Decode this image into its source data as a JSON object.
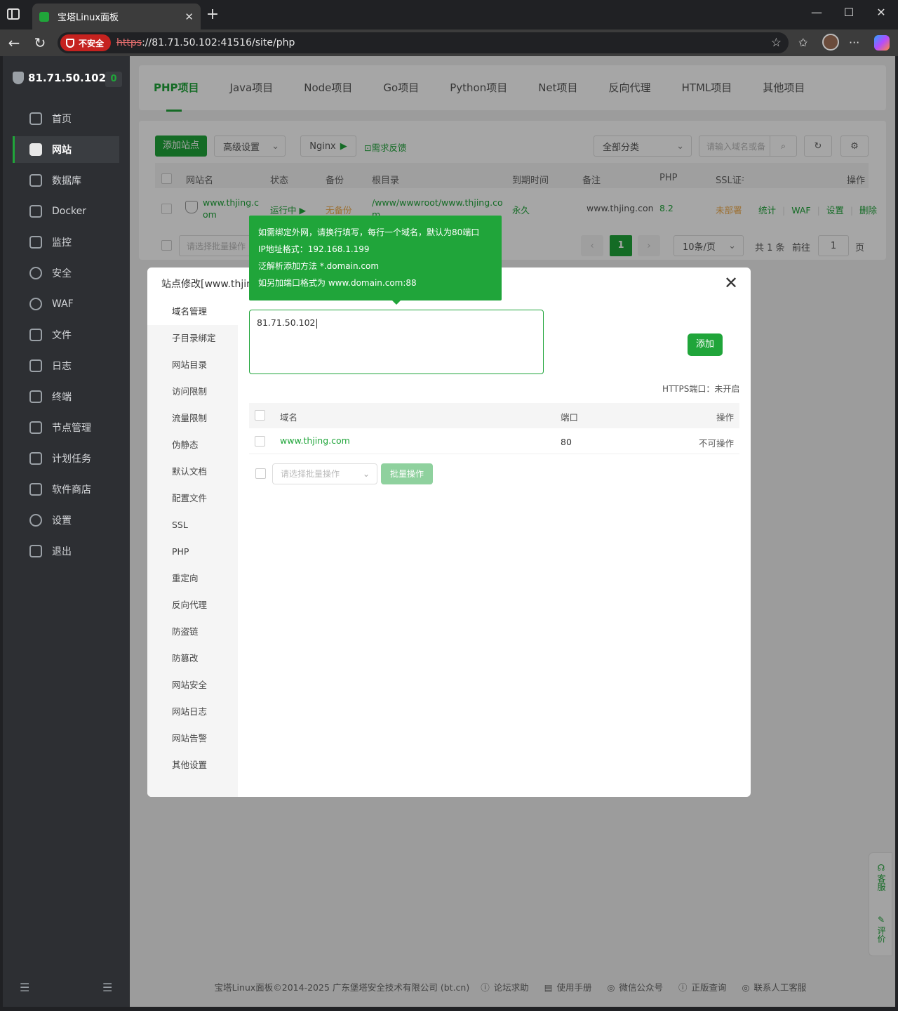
{
  "browser": {
    "tab_title": "宝塔Linux面板",
    "insecure_label": "不安全",
    "url_scheme": "https",
    "url_rest": "://81.71.50.102:41516/site/php"
  },
  "sidebar": {
    "server_ip": "81.71.50.102",
    "badge": "0",
    "items": [
      {
        "label": "首页"
      },
      {
        "label": "网站"
      },
      {
        "label": "数据库"
      },
      {
        "label": "Docker"
      },
      {
        "label": "监控"
      },
      {
        "label": "安全"
      },
      {
        "label": "WAF"
      },
      {
        "label": "文件"
      },
      {
        "label": "日志"
      },
      {
        "label": "终端"
      },
      {
        "label": "节点管理"
      },
      {
        "label": "计划任务"
      },
      {
        "label": "软件商店"
      },
      {
        "label": "设置"
      },
      {
        "label": "退出"
      }
    ],
    "active_index": 1
  },
  "project_tabs": [
    "PHP项目",
    "Java项目",
    "Node项目",
    "Go项目",
    "Python项目",
    "Net项目",
    "反向代理",
    "HTML项目",
    "其他项目"
  ],
  "toolbar": {
    "add_site": "添加站点",
    "advanced": "高级设置",
    "nginx": "Nginx",
    "feedback": "需求反馈",
    "category": "全部分类",
    "search_placeholder": "请输入域名或备"
  },
  "site_table": {
    "headers": {
      "name": "网站名",
      "status": "状态",
      "backup": "备份",
      "root": "根目录",
      "expire": "到期时间",
      "remark": "备注",
      "php": "PHP",
      "ssl": "SSL证书",
      "ops": "操作"
    },
    "row": {
      "name_line1": "www.thjing.c",
      "name_line2": "om",
      "status": "运行中",
      "backup": "无备份",
      "root": "/www/wwwroot/www.thjing.co",
      "root_line2": "m",
      "expire": "永久",
      "remark": "www.thjing.con",
      "php": "8.2",
      "ssl": "未部署",
      "ops": [
        "统计",
        "WAF",
        "设置",
        "删除"
      ]
    },
    "batch_placeholder": "请选择批量操作",
    "pager": {
      "current": "1",
      "per_page": "10条/页",
      "total": "共 1 条",
      "goto": "前往",
      "page_input": "1",
      "page_suffix": "页"
    }
  },
  "footer": {
    "copyright": "宝塔Linux面板©2014-2025 广东堡塔安全技术有限公司 (bt.cn)",
    "links": [
      "论坛求助",
      "使用手册",
      "微信公众号",
      "正版查询",
      "联系人工客服"
    ]
  },
  "side_widget": {
    "service": "客服",
    "review": "评价"
  },
  "dialog": {
    "title": "站点修改[www.thjin",
    "nav": [
      "域名管理",
      "子目录绑定",
      "网站目录",
      "访问限制",
      "流量限制",
      "伪静态",
      "默认文档",
      "配置文件",
      "SSL",
      "PHP",
      "重定向",
      "反向代理",
      "防盗链",
      "防篡改",
      "网站安全",
      "网站日志",
      "网站告警",
      "其他设置"
    ],
    "domain_input_value": "81.71.50.102",
    "add_button": "添加",
    "https_port_note": "HTTPS端口：未开启",
    "table": {
      "headers": {
        "domain": "域名",
        "port": "端口",
        "ops": "操作"
      },
      "rows": [
        {
          "domain": "www.thjing.com",
          "port": "80",
          "ops": "不可操作"
        }
      ]
    },
    "batch_placeholder": "请选择批量操作",
    "batch_button": "批量操作"
  },
  "tooltip": {
    "lines": [
      "如需绑定外网，请换行填写，每行一个域名，默认为80端口",
      "IP地址格式：192.168.1.199",
      "泛解析添加方法 *.domain.com",
      "如另加端口格式为 www.domain.com:88"
    ]
  },
  "colors": {
    "accent": "#20a53a",
    "warning": "#f0ad4e",
    "sidebar_bg": "#2d2f33"
  }
}
